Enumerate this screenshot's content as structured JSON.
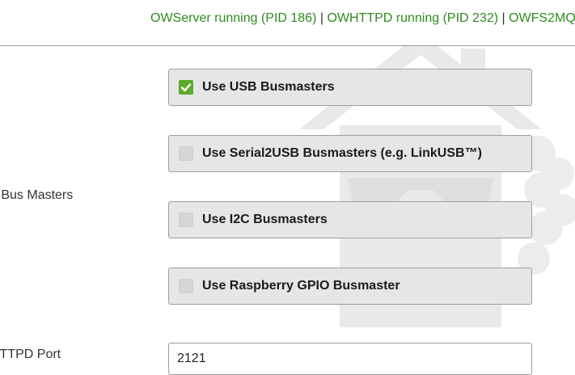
{
  "status": {
    "owserver": "OWServer running (PID 186)",
    "owhttpd": "OWHTTPD running (PID 232)",
    "owfs2mqtt": "OWFS2MQ",
    "separator": " | "
  },
  "form": {
    "bus_masters_label": "e Bus Masters",
    "options": [
      {
        "label": "Use USB Busmasters",
        "checked": true
      },
      {
        "label": "Use Serial2USB Busmasters (e.g. LinkUSB™)",
        "checked": false
      },
      {
        "label": "Use I2C Busmasters",
        "checked": false
      },
      {
        "label": "Use Raspberry GPIO Busmaster",
        "checked": false
      }
    ],
    "httpd_port_label": "HTTPD Port",
    "httpd_port_value": "2121"
  },
  "colors": {
    "running_text": "#2e8b1f",
    "checkbox_checked": "#5cab2e",
    "checkbox_unchecked": "#d6d6d6",
    "option_background": "#e6e6e6"
  },
  "icons": {
    "checked": "checkmark-icon",
    "background": "house-logo-icon"
  }
}
